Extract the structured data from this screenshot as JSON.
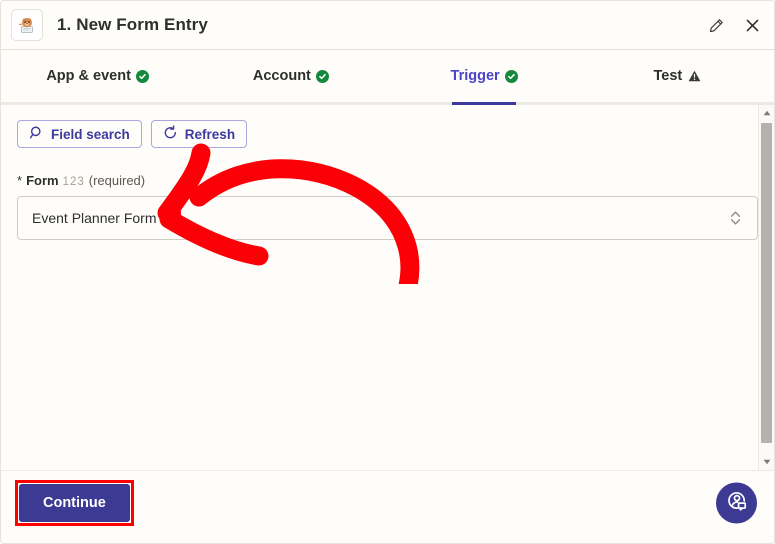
{
  "window": {
    "title": "1. New Form Entry",
    "app_icon": "wpforms-mascot-icon",
    "edit_icon": "pencil-icon",
    "close_icon": "close-icon"
  },
  "tabs": [
    {
      "label": "App & event",
      "status": "complete",
      "status_icon": "check-circle-icon",
      "active": false
    },
    {
      "label": "Account",
      "status": "complete",
      "status_icon": "check-circle-icon",
      "active": false
    },
    {
      "label": "Trigger",
      "status": "complete",
      "status_icon": "check-circle-icon",
      "active": true
    },
    {
      "label": "Test",
      "status": "warning",
      "status_icon": "warning-triangle-icon",
      "active": false
    }
  ],
  "toolbar": {
    "field_search_label": "Field search",
    "field_search_icon": "search-icon",
    "refresh_label": "Refresh",
    "refresh_icon": "refresh-icon"
  },
  "form_field": {
    "required_marker": "*",
    "label": "Form",
    "type_hint": "123",
    "required_text": "(required)",
    "selected_value": "Event Planner Form",
    "chevron_icon": "chevron-up-down-icon"
  },
  "footer": {
    "continue_label": "Continue",
    "help_icon": "support-agent-icon"
  },
  "scrollbar": {
    "up_arrow_icon": "scroll-up-arrow-icon",
    "down_arrow_icon": "scroll-down-arrow-icon"
  },
  "annotation": {
    "arrow_color": "#fb0007",
    "highlight_color": "#ff0000",
    "arrow_icon": "red-curved-arrow-annotation"
  },
  "colors": {
    "accent": "#3d3a94",
    "accent_text": "#4a46c9",
    "success": "#14883d",
    "background": "#fffdf9",
    "border": "#cfccc6"
  }
}
